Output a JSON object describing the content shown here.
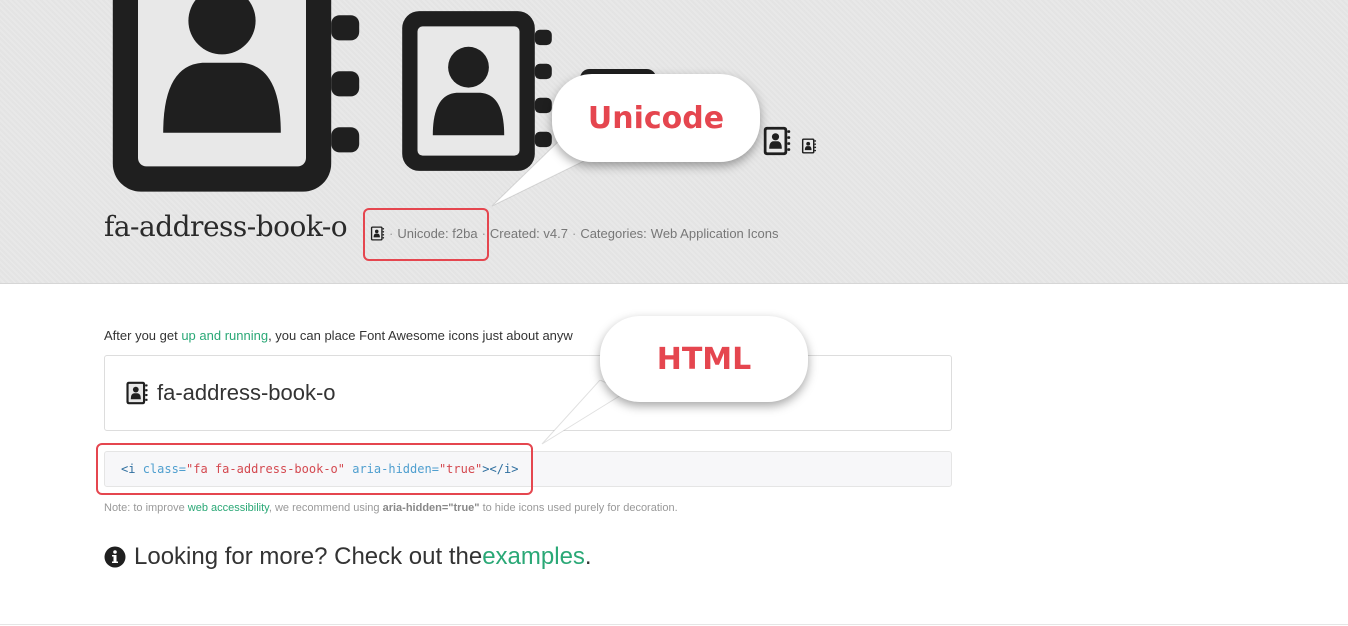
{
  "icon": {
    "name": "fa-address-book-o",
    "icon_name": "address-book-o-icon"
  },
  "header": {
    "title": "fa-address-book-o",
    "unicode": "Unicode: f2ba",
    "created": "Created: v4.7",
    "categories_label": "Categories:",
    "categories_link": "Web Application Icons"
  },
  "callouts": {
    "unicode": "Unicode",
    "html": "HTML"
  },
  "intro": {
    "prefix": "After you get ",
    "link": "up and running",
    "suffix": ", you can place Font Awesome icons just about anyw"
  },
  "demo": {
    "label": "fa-address-book-o"
  },
  "code": {
    "open": "<i",
    "class_attr": "class=",
    "class_val": "\"fa fa-address-book-o\"",
    "aria_attr": "aria-hidden=",
    "aria_val": "\"true\"",
    "close": "></i>"
  },
  "note": {
    "prefix": "Note: to improve ",
    "link": "web accessibility",
    "middle": ", we recommend using ",
    "bold": "aria-hidden=\"true\"",
    "suffix": " to hide icons used purely for decoration."
  },
  "more": {
    "icon_name": "info-circle-icon",
    "prefix": "Looking for more? Check out the ",
    "link": "examples",
    "suffix": "."
  },
  "colors": {
    "accent": "#e5464f",
    "link": "#2aa876",
    "icon": "#1f1f1f"
  }
}
